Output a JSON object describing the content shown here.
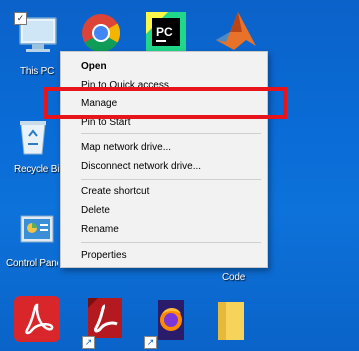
{
  "desktop": {
    "icons": {
      "this_pc": "This PC",
      "recycle_bin": "Recycle Bin",
      "control_panel": "Control Panel",
      "code": "Code"
    }
  },
  "context_menu": {
    "items": [
      {
        "label": "Open",
        "bold": true
      },
      {
        "label": "Pin to Quick access"
      },
      {
        "label": "Manage"
      },
      {
        "label": "Pin to Start"
      },
      {
        "label": "Map network drive..."
      },
      {
        "label": "Disconnect network drive..."
      },
      {
        "label": "Create shortcut"
      },
      {
        "label": "Delete"
      },
      {
        "label": "Rename"
      },
      {
        "label": "Properties"
      }
    ]
  },
  "colors": {
    "desktop_bg": "#0a6bd6",
    "highlight_border": "#e8141c",
    "menu_bg": "#f2f2f2"
  }
}
